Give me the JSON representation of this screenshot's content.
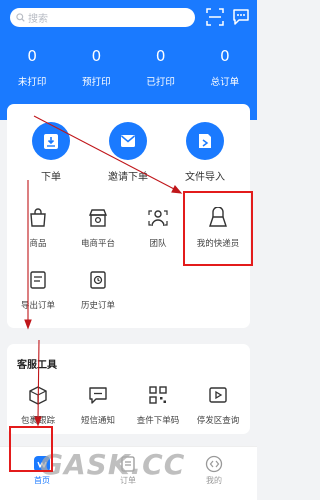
{
  "search": {
    "placeholder": "搜索"
  },
  "stats": [
    {
      "value": "0",
      "label": "未打印"
    },
    {
      "value": "0",
      "label": "预打印"
    },
    {
      "value": "0",
      "label": "已打印"
    },
    {
      "value": "0",
      "label": "总订单"
    }
  ],
  "main_actions": [
    {
      "label": "下单"
    },
    {
      "label": "邀请下单"
    },
    {
      "label": "文件导入"
    }
  ],
  "grid": [
    {
      "label": "商品"
    },
    {
      "label": "电商平台"
    },
    {
      "label": "团队"
    },
    {
      "label": "我的快递员"
    },
    {
      "label": "导出订单"
    },
    {
      "label": "历史订单"
    }
  ],
  "service": {
    "title": "客服工具",
    "items": [
      {
        "label": "包裹跟踪"
      },
      {
        "label": "短信通知"
      },
      {
        "label": "查件下单码"
      },
      {
        "label": "停发区查询"
      }
    ]
  },
  "tabbar": [
    {
      "label": "首页"
    },
    {
      "label": "订单"
    },
    {
      "label": "我的"
    }
  ],
  "watermark": "GASK.CC",
  "colors": {
    "accent": "#1a7aff",
    "annotation": "#e31b1b"
  }
}
